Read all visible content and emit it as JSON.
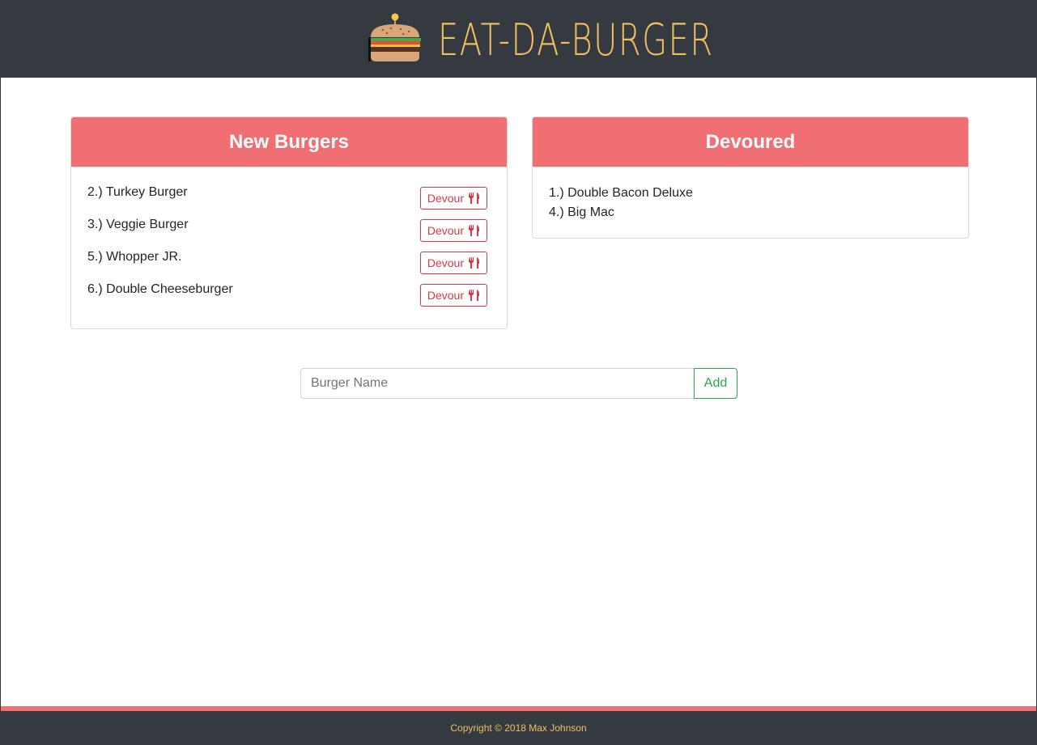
{
  "header": {
    "title": "EAT-DA-BURGER",
    "logo_icon": "burger-icon"
  },
  "new_burgers": {
    "title": "New Burgers",
    "items": [
      {
        "name": "2.) Turkey Burger",
        "button_label": "Devour"
      },
      {
        "name": "3.) Veggie Burger",
        "button_label": "Devour"
      },
      {
        "name": "5.) Whopper JR.",
        "button_label": "Devour"
      },
      {
        "name": "6.) Double Cheeseburger",
        "button_label": "Devour"
      }
    ],
    "button_icon": "utensils-icon"
  },
  "devoured": {
    "title": "Devoured",
    "items": [
      {
        "name": "1.) Double Bacon Deluxe"
      },
      {
        "name": "4.) Big Mac"
      }
    ]
  },
  "add_form": {
    "placeholder": "Burger Name",
    "value": "",
    "button_label": "Add"
  },
  "footer": {
    "text": "Copyright © 2018 Max Johnson"
  },
  "colors": {
    "header_bg": "#343a40",
    "accent": "#ef6f73",
    "title_gold": "#f0c060",
    "devour_red": "#dc3545",
    "add_green": "#28a745"
  }
}
